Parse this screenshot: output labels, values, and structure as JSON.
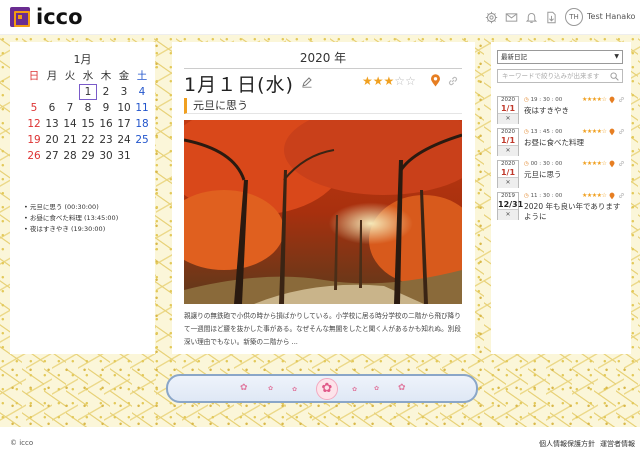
{
  "header": {
    "logo_text": "icco",
    "avatar_initials": "TH",
    "username": "Test Hanako"
  },
  "calendar": {
    "month": "1月",
    "weekdays": [
      "日",
      "月",
      "火",
      "水",
      "木",
      "金",
      "土"
    ],
    "weeks": [
      [
        "",
        "",
        "",
        "1",
        "2",
        "3",
        "4"
      ],
      [
        "5",
        "6",
        "7",
        "8",
        "9",
        "10",
        "11"
      ],
      [
        "12",
        "13",
        "14",
        "15",
        "16",
        "17",
        "18"
      ],
      [
        "19",
        "20",
        "21",
        "22",
        "23",
        "24",
        "25"
      ],
      [
        "26",
        "27",
        "28",
        "29",
        "30",
        "31",
        ""
      ]
    ],
    "today": "1",
    "entries": [
      "• 元旦に思う (00:30:00)",
      "• お昼に食べた料理 (13:45:00)",
      "• 夜はすきやき (19:30:00)"
    ]
  },
  "main": {
    "year": "2020 年",
    "date_title": "1月１日(水)",
    "rating": 3,
    "rating_max": 5,
    "subtitle": "元旦に思う",
    "body": "親譲りの無鉄砲で小供の時から損ばかりしている。小学校に居る時分学校の二階から飛び降りて一週間ほど腰を抜かした事がある。なぜそんな無闇をしたと聞く人があるかも知れぬ。別段深い理由でもない。新築の二階から ..."
  },
  "sidebar": {
    "select_value": "最新日記",
    "search_placeholder": "キーワードで絞り込みが出来ます",
    "items": [
      {
        "year": "2020",
        "day": "1/1",
        "close": "✕",
        "time": "19 : 30 : 00",
        "title": "夜はすきやき",
        "stars": "★★★★☆"
      },
      {
        "year": "2020",
        "day": "1/1",
        "close": "✕",
        "time": "13 : 45 : 00",
        "title": "お昼に食べた料理",
        "stars": "★★★★☆"
      },
      {
        "year": "2020",
        "day": "1/1",
        "close": "✕",
        "time": "00 : 30 : 00",
        "title": "元旦に思う",
        "stars": "★★★★☆"
      },
      {
        "year": "2019",
        "day": "12/31",
        "close": "✕",
        "time": "11 : 30 : 00",
        "title": "2020 年も良い年でありますように",
        "stars": "★★★★☆"
      }
    ]
  },
  "footer": {
    "copyright": "© icco",
    "privacy": "個人情報保護方針",
    "operator": "運営者情報"
  },
  "colors": {
    "accent": "#f0a020",
    "sunday": "#dd3333",
    "saturday": "#2255cc",
    "pattern_bg": "#fbf6d9"
  }
}
